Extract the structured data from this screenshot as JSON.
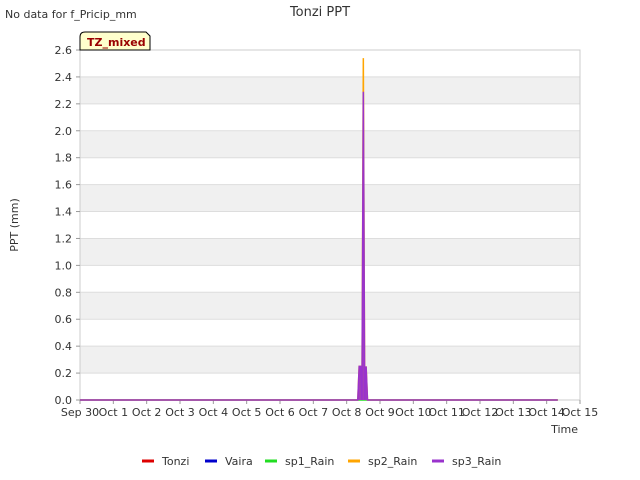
{
  "chart_data": {
    "type": "line",
    "title": "Tonzi PPT",
    "note": "No data for f_Pricip_mm",
    "badge": "TZ_mixed",
    "xlabel": "Time",
    "ylabel": "PPT (mm)",
    "x_ticks": [
      "Sep 30",
      "Oct 1",
      "Oct 2",
      "Oct 3",
      "Oct 4",
      "Oct 5",
      "Oct 6",
      "Oct 7",
      "Oct 8",
      "Oct 9",
      "Oct 10",
      "Oct 11",
      "Oct 12",
      "Oct 13",
      "Oct 14",
      "Oct 15"
    ],
    "xlim": [
      "Sep 30",
      "Oct 15"
    ],
    "ylim": [
      0,
      2.6
    ],
    "y_ticks": [
      "0.0",
      "0.2",
      "0.4",
      "0.6",
      "0.8",
      "1.0",
      "1.2",
      "1.4",
      "1.6",
      "1.8",
      "2.0",
      "2.2",
      "2.4",
      "2.6"
    ],
    "grid": "horizontal bands",
    "legend_position": "bottom",
    "series": [
      {
        "name": "Tonzi",
        "color": "#dd0000",
        "points": []
      },
      {
        "name": "Vaira",
        "color": "#0000cc",
        "points": []
      },
      {
        "name": "sp1_Rain",
        "color": "#22dd22",
        "points": [
          [
            "Sep 30 00:00",
            0
          ],
          [
            "Oct 14 08:00",
            0
          ]
        ]
      },
      {
        "name": "sp2_Rain",
        "color": "#ffa500",
        "points": [
          [
            "Sep 30 00:00",
            0
          ],
          [
            "Oct 8 08:00",
            0
          ],
          [
            "Oct 8 09:00",
            0.25
          ],
          [
            "Oct 8 10:00",
            0.25
          ],
          [
            "Oct 8 11:00",
            0
          ],
          [
            "Oct 8 12:00",
            2.54
          ],
          [
            "Oct 8 13:00",
            0
          ],
          [
            "Oct 8 14:00",
            0.25
          ],
          [
            "Oct 8 15:00",
            0
          ],
          [
            "Oct 14 08:00",
            0
          ]
        ]
      },
      {
        "name": "sp3_Rain",
        "color": "#9933cc",
        "points": [
          [
            "Sep 30 00:00",
            0
          ],
          [
            "Oct 8 08:00",
            0
          ],
          [
            "Oct 8 09:00",
            0.25
          ],
          [
            "Oct 8 10:00",
            0.25
          ],
          [
            "Oct 8 11:00",
            0
          ],
          [
            "Oct 8 12:00",
            2.29
          ],
          [
            "Oct 8 13:00",
            0
          ],
          [
            "Oct 8 14:00",
            0.25
          ],
          [
            "Oct 8 15:00",
            0
          ],
          [
            "Oct 14 08:00",
            0
          ]
        ]
      }
    ]
  }
}
